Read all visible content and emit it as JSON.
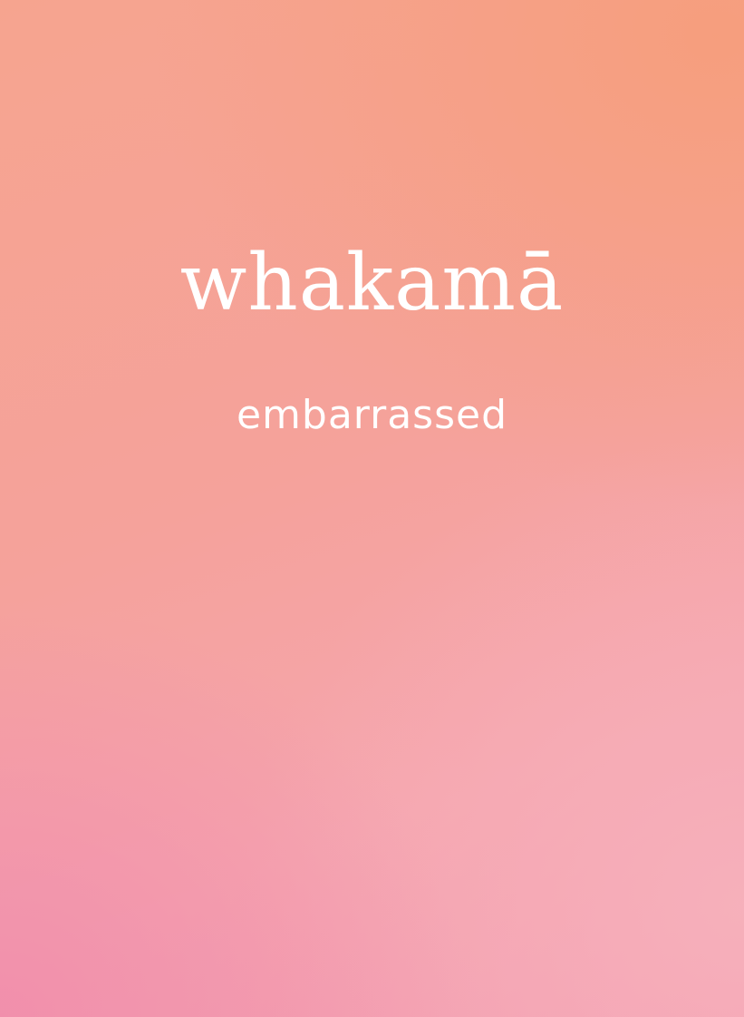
{
  "card": {
    "word": "whakamā",
    "translation": "embarrassed"
  },
  "colors": {
    "gradient_top_right": "#f6a07e",
    "gradient_middle": "#f5a6a4",
    "gradient_bottom_left": "#f193ae",
    "gradient_bottom_right": "#f6b0bc",
    "text": "#ffffff"
  }
}
